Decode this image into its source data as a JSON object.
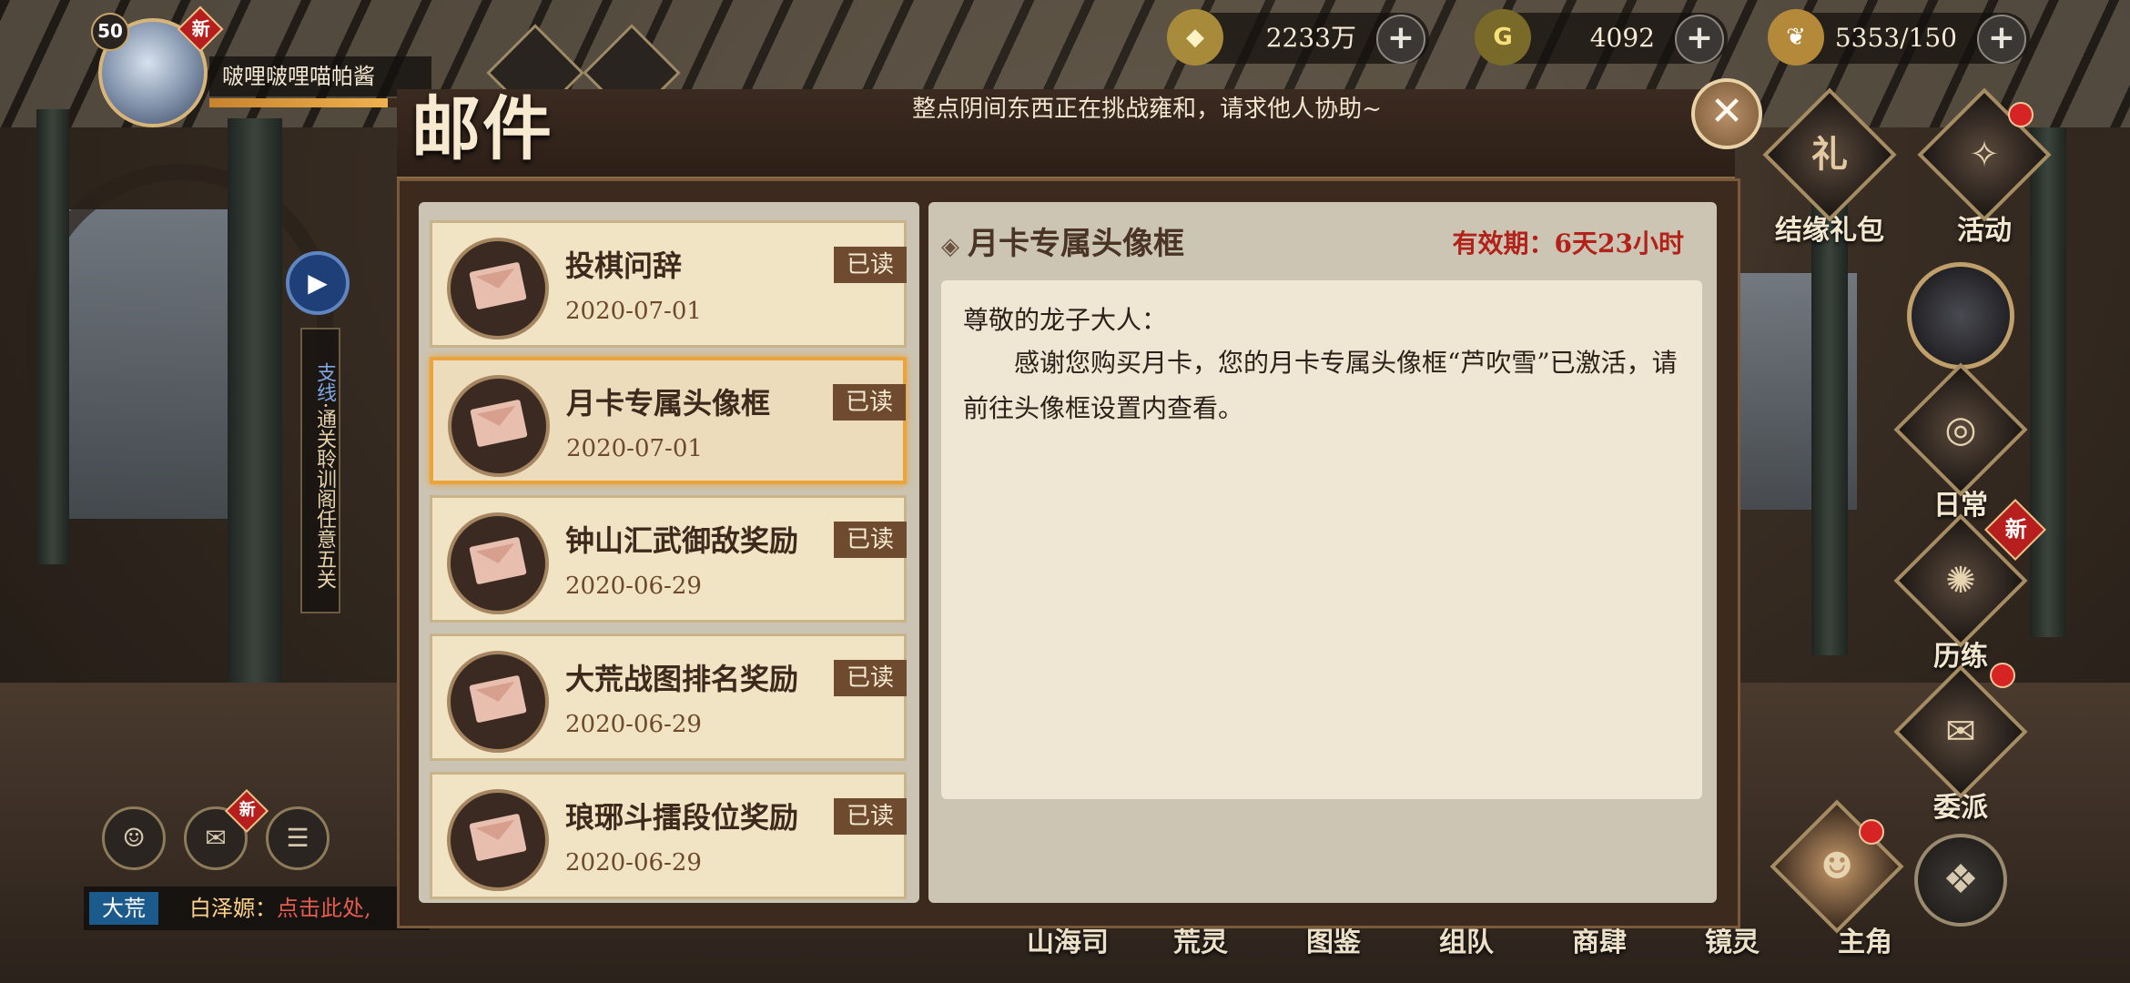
{
  "player": {
    "level": "50",
    "name": "啵哩啵哩喵帕酱",
    "new_badge": "新",
    "exp_fraction": 0.85
  },
  "currencies": [
    {
      "icon": "coin-icon",
      "value": "2233万"
    },
    {
      "icon": "jade-icon",
      "value": "4092"
    },
    {
      "icon": "stamina-icon",
      "value": "5353/150"
    }
  ],
  "mail": {
    "title": "邮件",
    "notice": "整点阴间东西正在挑战雍和，请求他人协助~",
    "items": [
      {
        "title": "投棋问辞",
        "date": "2020-07-01",
        "status": "已读"
      },
      {
        "title": "月卡专属头像框",
        "date": "2020-07-01",
        "status": "已读"
      },
      {
        "title": "钟山汇武御敌奖励",
        "date": "2020-06-29",
        "status": "已读"
      },
      {
        "title": "大荒战图排名奖励",
        "date": "2020-06-29",
        "status": "已读"
      },
      {
        "title": "琅琊斗擂段位奖励",
        "date": "2020-06-29",
        "status": "已读"
      }
    ],
    "detail": {
      "title": "月卡专属头像框",
      "expire": "有效期：6天23小时",
      "greeting": "尊敬的龙子大人：",
      "content": "感谢您购买月卡，您的月卡专属头像框“芦吹雪”已激活，请前往头像框设置内查看。"
    }
  },
  "quest": {
    "tag": "支线",
    "text": "·通关聆训阁任意五关"
  },
  "chat": {
    "channel": "大荒",
    "name": "白泽嫄：",
    "message": "点击此处,"
  },
  "side_nav": [
    "结缘礼包",
    "活动",
    "日常",
    "历练",
    "委派"
  ],
  "bottom_nav": [
    "山海司",
    "荒灵",
    "图鉴",
    "组队",
    "商肆",
    "镜灵",
    "主角"
  ],
  "badges": {
    "new": "新",
    "gift_char": "礼"
  },
  "colors": {
    "expire_red": "#b2221a",
    "selected_border": "#e9a43e",
    "read_tag": "#6e4a2e"
  }
}
